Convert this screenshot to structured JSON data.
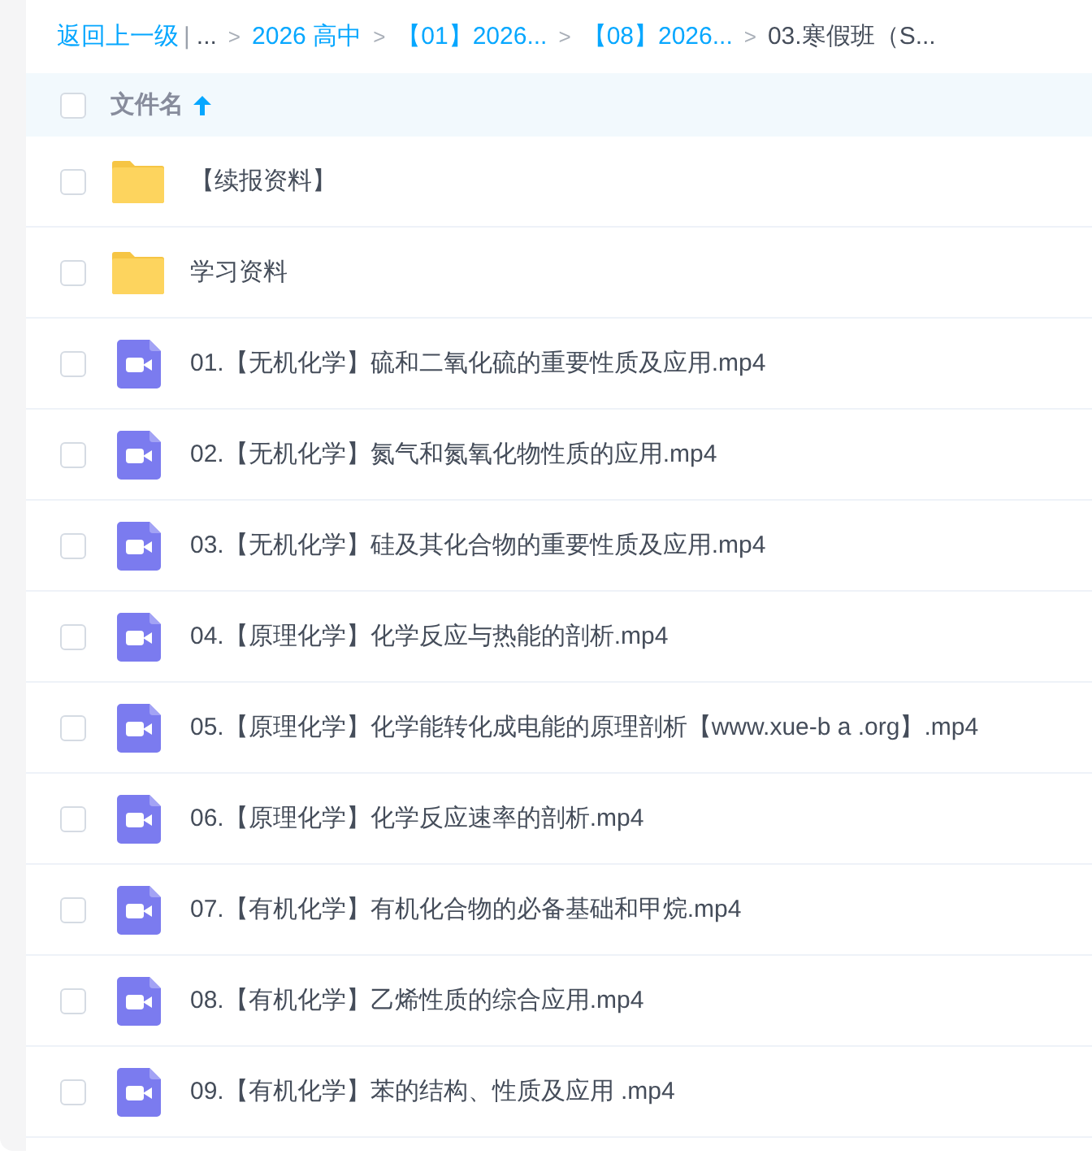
{
  "breadcrumb": {
    "back": "返回上一级",
    "divider": "|",
    "items": [
      {
        "label": "...",
        "kind": "ellipsis"
      },
      {
        "separator": ">",
        "label": "2026 高中",
        "kind": "link"
      },
      {
        "separator": ">",
        "label": "【01】2026...",
        "kind": "link"
      },
      {
        "separator": ">",
        "label": "【08】2026...",
        "kind": "link"
      },
      {
        "separator": ">",
        "label": "03.寒假班（S...",
        "kind": "current"
      }
    ]
  },
  "header": {
    "checked": false,
    "label": "文件名",
    "sort_ascending": true
  },
  "rows": [
    {
      "kind": "folder",
      "name": "【续报资料】",
      "checked": false
    },
    {
      "kind": "folder",
      "name": "学习资料",
      "checked": false
    },
    {
      "kind": "video",
      "name": "01.【无机化学】硫和二氧化硫的重要性质及应用.mp4",
      "checked": false
    },
    {
      "kind": "video",
      "name": "02.【无机化学】氮气和氮氧化物性质的应用.mp4",
      "checked": false
    },
    {
      "kind": "video",
      "name": "03.【无机化学】硅及其化合物的重要性质及应用.mp4",
      "checked": false
    },
    {
      "kind": "video",
      "name": "04.【原理化学】化学反应与热能的剖析.mp4",
      "checked": false
    },
    {
      "kind": "video",
      "name": "05.【原理化学】化学能转化成电能的原理剖析【www.xue-b a .org】.mp4",
      "checked": false
    },
    {
      "kind": "video",
      "name": "06.【原理化学】化学反应速率的剖析.mp4",
      "checked": false
    },
    {
      "kind": "video",
      "name": "07.【有机化学】有机化合物的必备基础和甲烷.mp4",
      "checked": false
    },
    {
      "kind": "video",
      "name": "08.【有机化学】乙烯性质的综合应用.mp4",
      "checked": false
    },
    {
      "kind": "video",
      "name": "09.【有机化学】苯的结构、性质及应用 .mp4",
      "checked": false
    }
  ]
}
